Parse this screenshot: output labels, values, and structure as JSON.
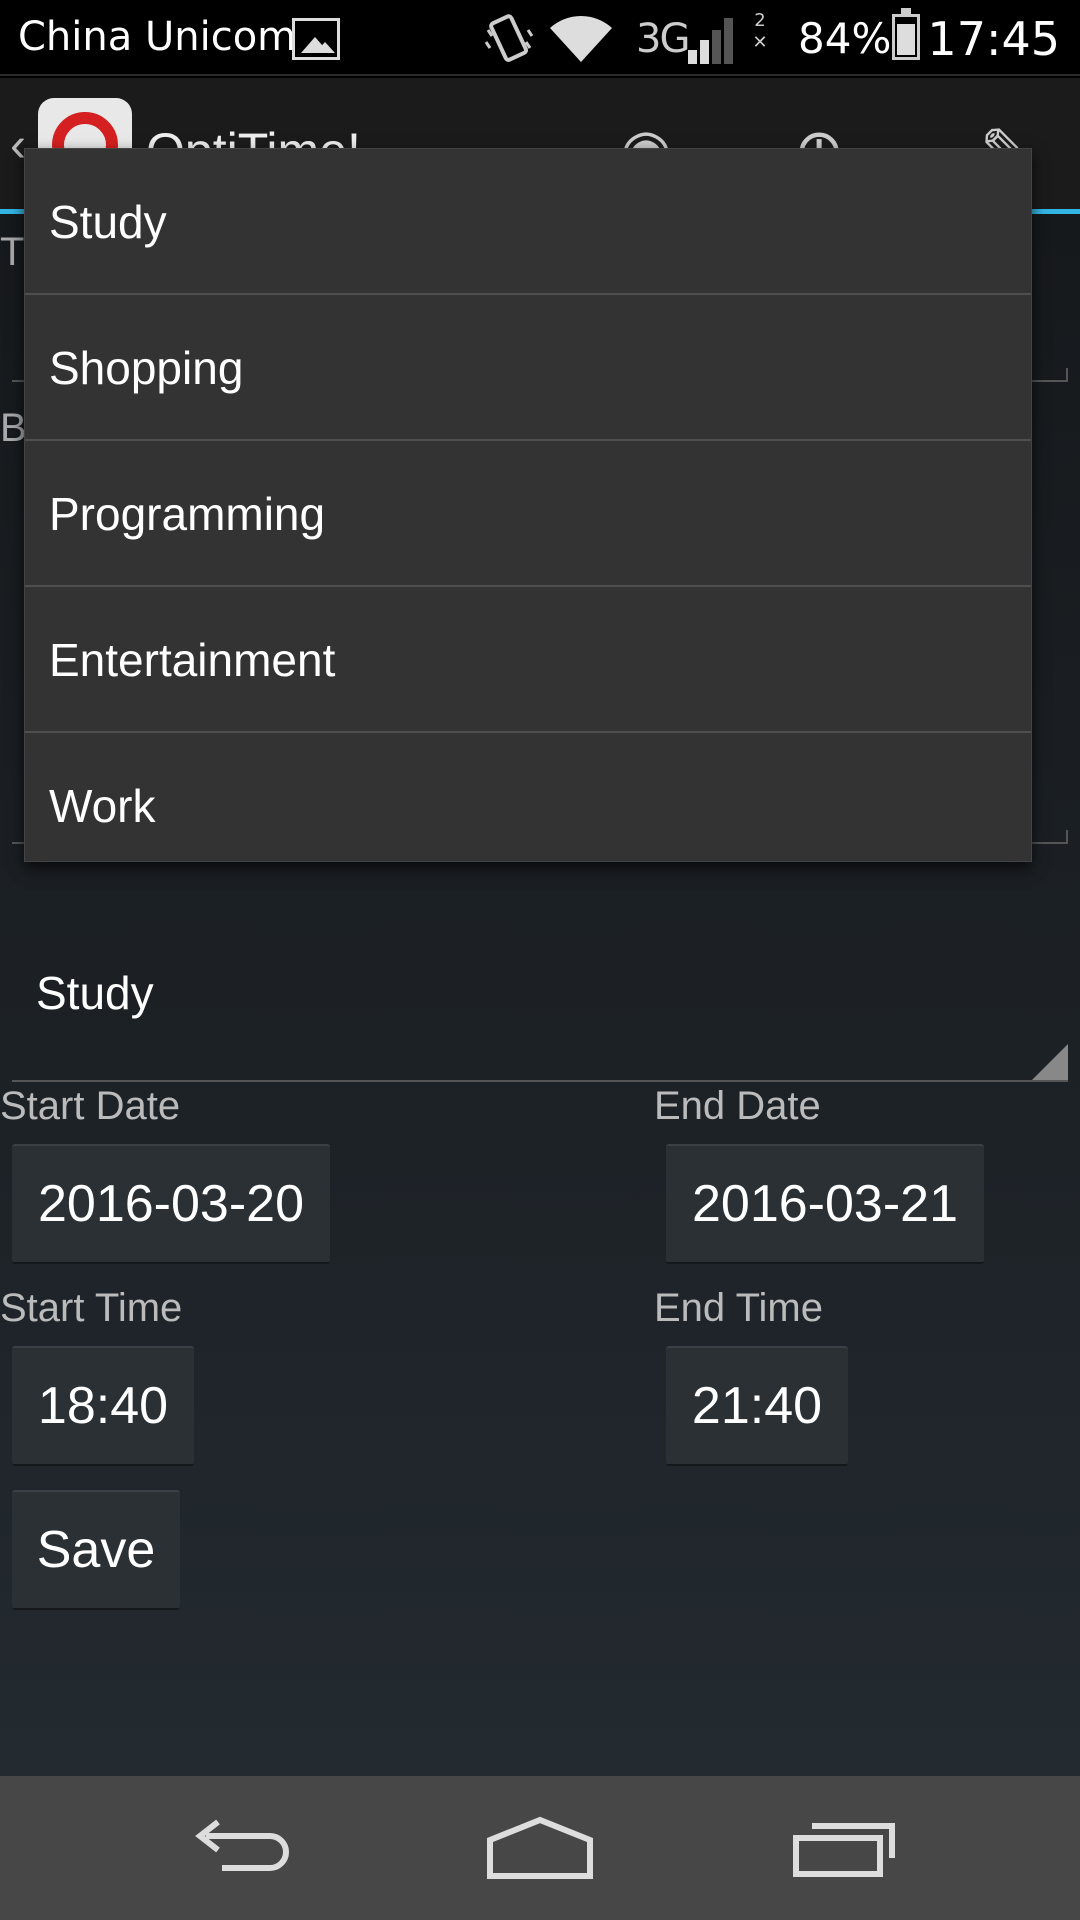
{
  "status_bar": {
    "carrier": "China Unicom",
    "network": "3G",
    "sim1": "1",
    "sim2": "2",
    "battery_percent": "84%",
    "battery_level": 0.84,
    "time": "17:45",
    "icons": [
      "image-icon",
      "vibrate-icon",
      "wifi-icon",
      "signal-icon",
      "battery-icon"
    ]
  },
  "action_bar": {
    "title": "OptiTime!",
    "icons": [
      "back-caret-icon",
      "app-logo-icon",
      "eye-icon",
      "add-icon",
      "wrench-icon"
    ],
    "accent_color": "#33b5e5"
  },
  "form": {
    "title_label_partial": "T",
    "body_label_partial": "B",
    "category_value": "Study",
    "start_date_label": "Start Date",
    "start_date": "2016-03-20",
    "end_date_label": "End Date",
    "end_date": "2016-03-21",
    "start_time_label": "Start Time",
    "start_time": "18:40",
    "end_time_label": "End Time",
    "end_time": "21:40",
    "save_label": "Save"
  },
  "dropdown": {
    "items": [
      "Study",
      "Shopping",
      "Programming",
      "Entertainment",
      "Work"
    ]
  },
  "nav_bar": {
    "icons": [
      "back-icon",
      "home-icon",
      "recents-icon"
    ]
  }
}
